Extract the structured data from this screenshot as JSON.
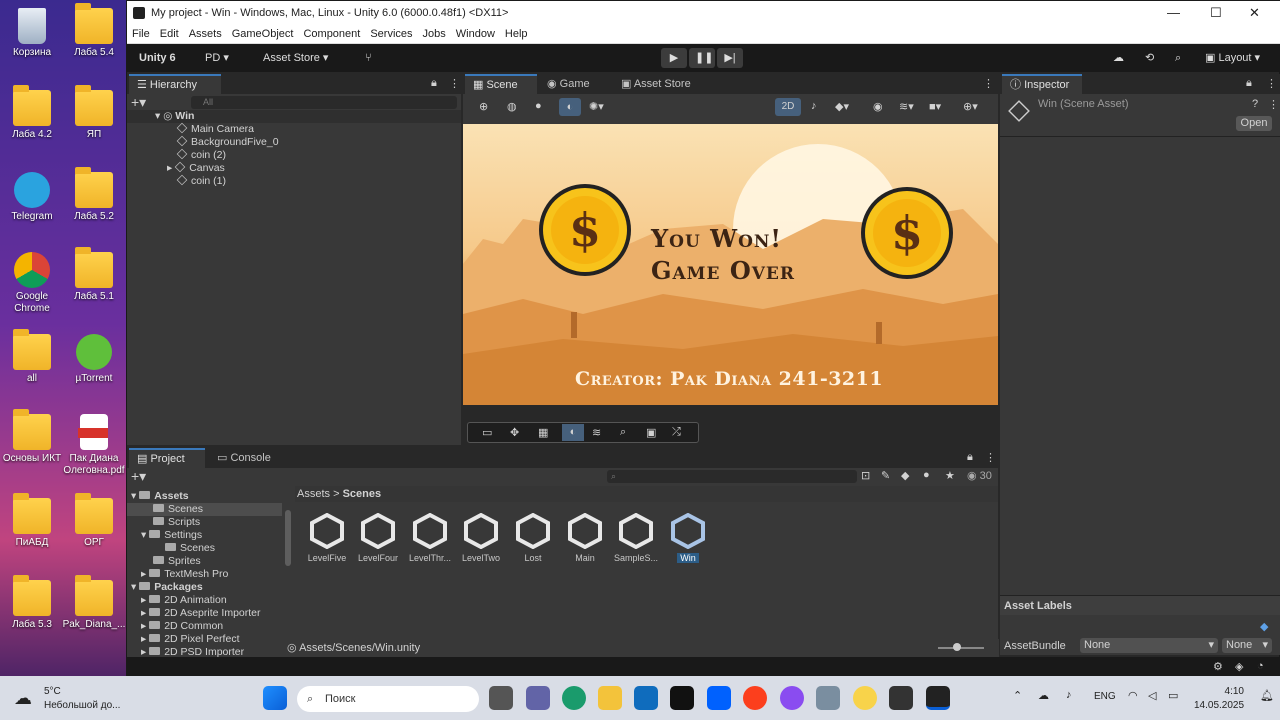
{
  "desktop": {
    "icons": [
      {
        "label": "Корзина"
      },
      {
        "label": "Лаба 5.4"
      },
      {
        "label": "Лаба 4.2"
      },
      {
        "label": "ЯП"
      },
      {
        "label": "Telegram"
      },
      {
        "label": "Лаба 5.2"
      },
      {
        "label": "Google Chrome"
      },
      {
        "label": "Лаба 5.1"
      },
      {
        "label": "all"
      },
      {
        "label": "µTorrent"
      },
      {
        "label": "Основы ИКТ"
      },
      {
        "label": "Пак Диана Олеговна.pdf"
      },
      {
        "label": "ПиАБД"
      },
      {
        "label": "ОРГ"
      },
      {
        "label": "Лаба 5.3"
      },
      {
        "label": "Pak_Diana_..."
      }
    ]
  },
  "window": {
    "title": "My project - Win - Windows, Mac, Linux - Unity 6.0 (6000.0.48f1) <DX11>",
    "controls": {
      "minimize": "—",
      "maximize": "☐",
      "close": "✕"
    }
  },
  "menu": [
    "File",
    "Edit",
    "Assets",
    "GameObject",
    "Component",
    "Services",
    "Jobs",
    "Window",
    "Help"
  ],
  "toolbar": {
    "unity_label": "Unity 6",
    "pd_label": "PD",
    "asset_store_label": "Asset Store",
    "layout_label": "Layout"
  },
  "hierarchy": {
    "tab": "Hierarchy",
    "search_placeholder": "All",
    "scene": "Win",
    "items": [
      "Main Camera",
      "BackgroundFive_0",
      "coin (2)",
      "Canvas",
      "coin (1)"
    ]
  },
  "scene_view": {
    "tabs": [
      "Scene",
      "Game",
      "Asset Store"
    ],
    "mode_2d": "2D",
    "title_line1": "You Won!",
    "title_line2": "Game Over",
    "creator": "Creator: Pak Diana 241-3211",
    "coin_symbol": "$"
  },
  "inspector": {
    "tab": "Inspector",
    "asset_name": "Win (Scene Asset)",
    "open_button": "Open",
    "asset_labels": "Asset Labels",
    "asset_bundle_label": "AssetBundle",
    "asset_bundle_value": "None",
    "asset_bundle_variant": "None"
  },
  "project": {
    "tabs": [
      "Project",
      "Console"
    ],
    "breadcrumb_root": "Assets",
    "breadcrumb_current": "Scenes",
    "count": "30",
    "tree": [
      "Assets",
      "Scenes",
      "Scripts",
      "Settings",
      "Scenes",
      "Sprites",
      "TextMesh Pro",
      "Packages",
      "2D Animation",
      "2D Aseprite Importer",
      "2D Common",
      "2D Pixel Perfect",
      "2D PSD Importer"
    ],
    "assets": [
      "LevelFive",
      "LevelFour",
      "LevelThr...",
      "LevelTwo",
      "Lost",
      "Main",
      "SampleS...",
      "Win"
    ],
    "path": "Assets/Scenes/Win.unity"
  },
  "taskbar": {
    "weather_temp": "5°C",
    "weather_desc": "Небольшой до...",
    "search_placeholder": "Поиск",
    "lang": "ENG",
    "time": "4:10",
    "date": "14.05.2025"
  },
  "colors": {
    "unity_bg": "#282828",
    "panel": "#383838",
    "accent": "#3a79bb",
    "sky": "#f6c98a",
    "ground": "#e09a47",
    "coin": "#f7c31b"
  }
}
